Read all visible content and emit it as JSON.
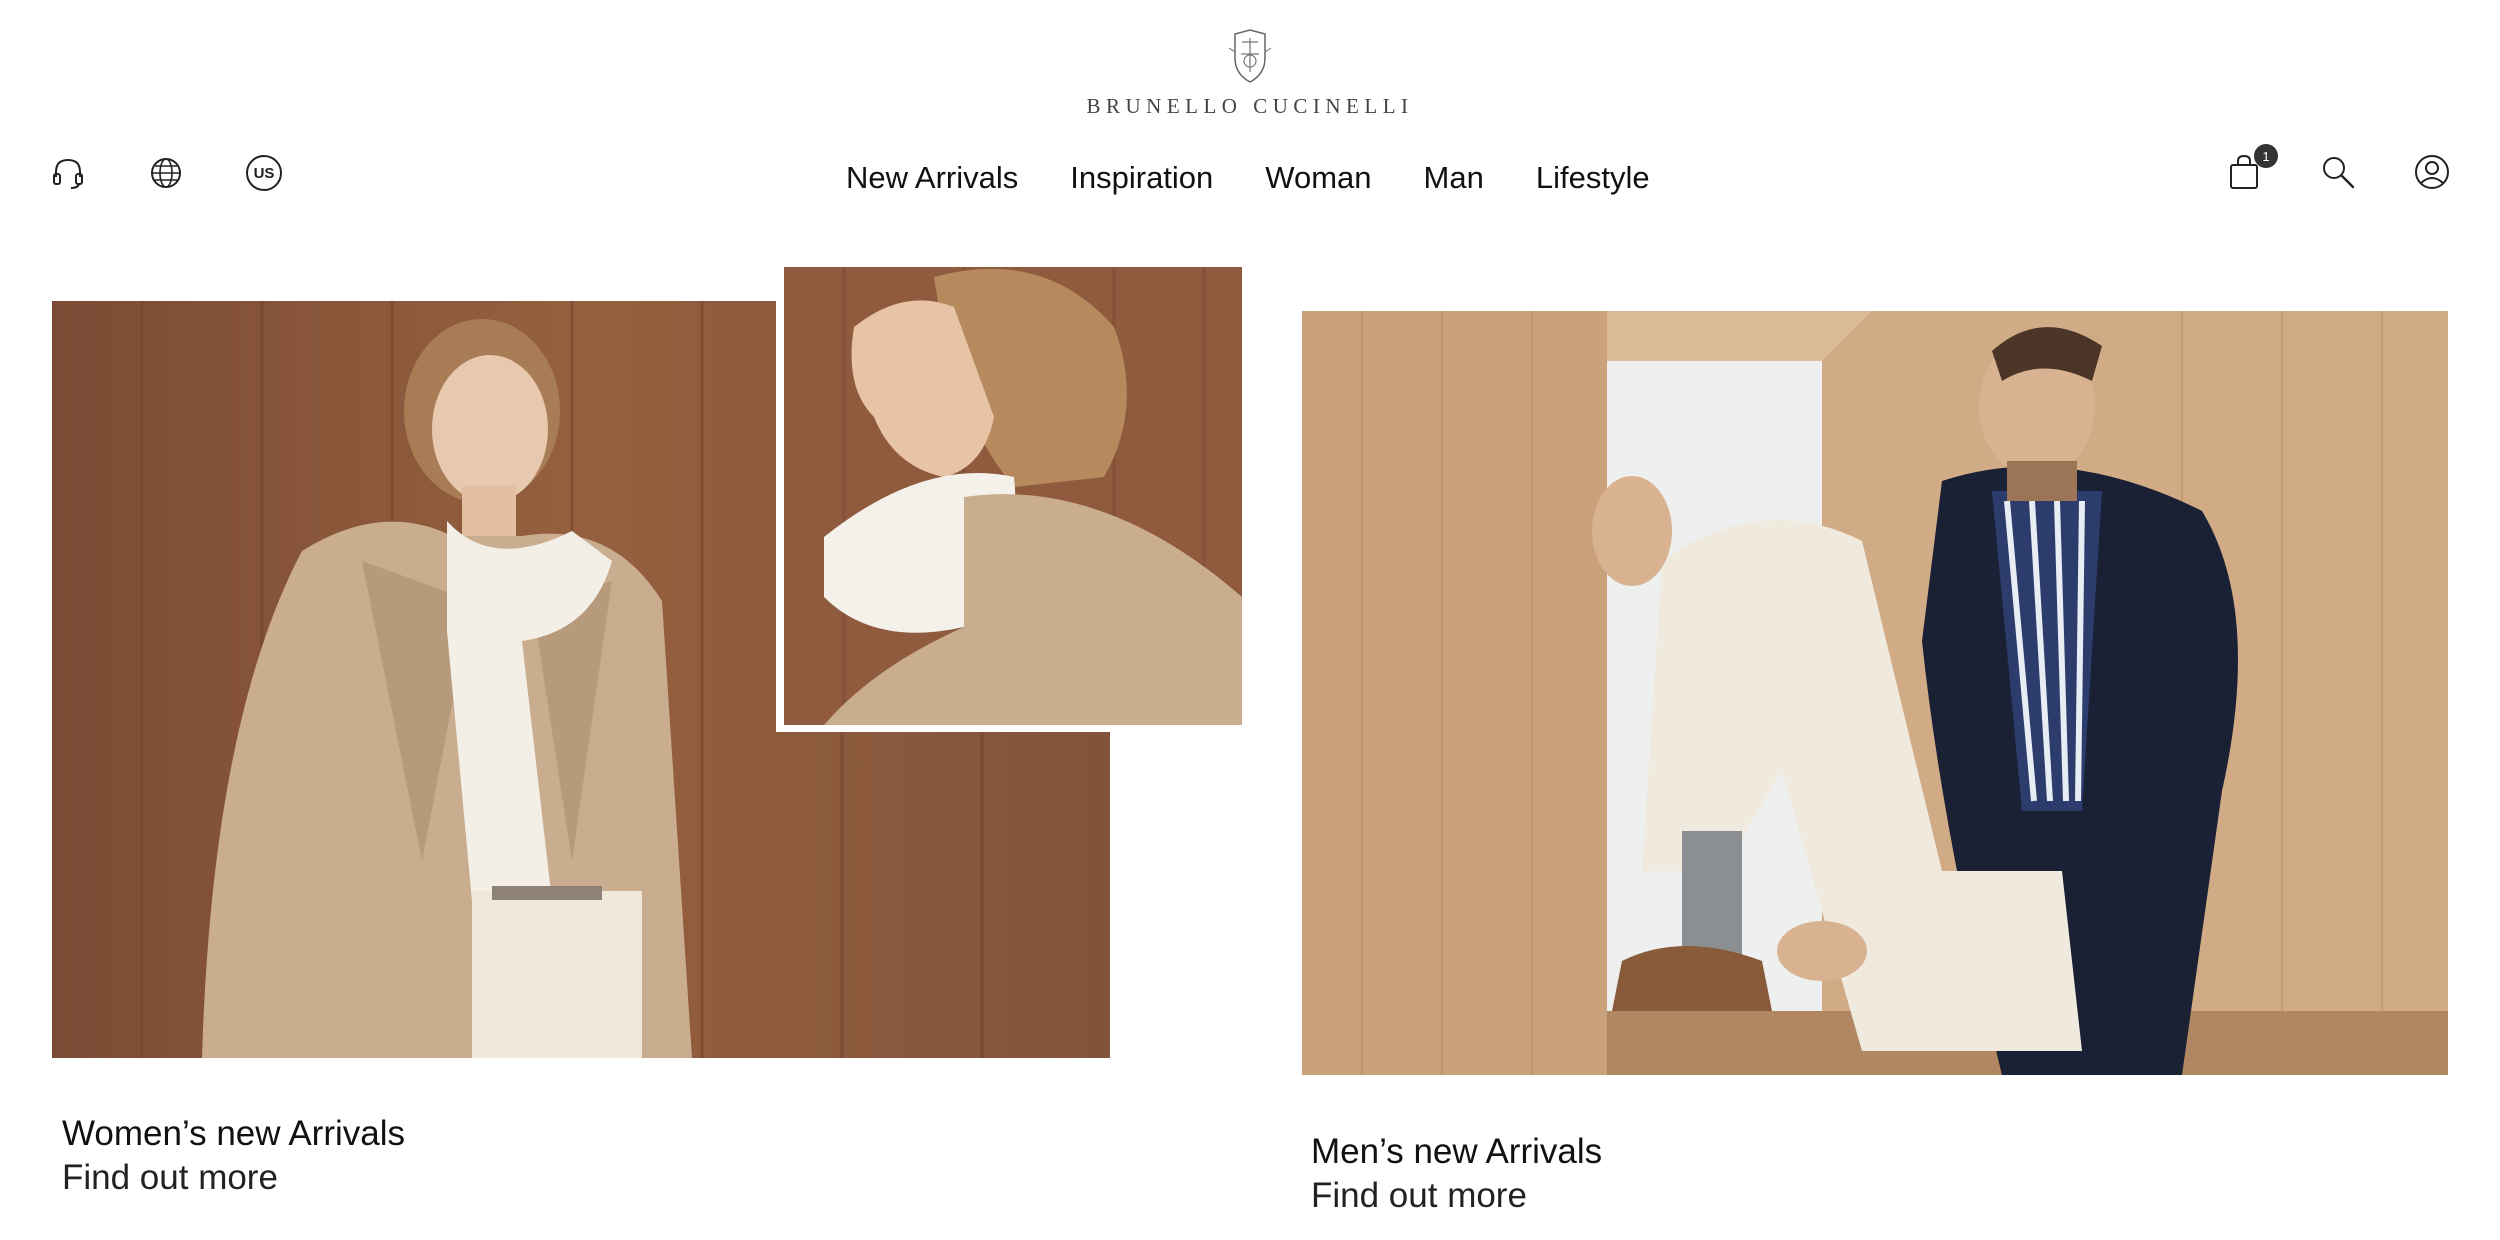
{
  "brand": {
    "name": "BRUNELLO CUCINELLI",
    "logo_icon": "crest-icon"
  },
  "header": {
    "left_tools": [
      {
        "name": "customer-service",
        "icon": "headset-icon"
      },
      {
        "name": "country",
        "icon": "globe-icon"
      },
      {
        "name": "locale",
        "label": "US"
      }
    ],
    "nav": [
      {
        "label": "New Arrivals"
      },
      {
        "label": "Inspiration"
      },
      {
        "label": "Woman"
      },
      {
        "label": "Man"
      },
      {
        "label": "Lifestyle"
      }
    ],
    "right_tools": [
      {
        "name": "shopping-bag",
        "icon": "shopping-bag-icon",
        "count": "1"
      },
      {
        "name": "search",
        "icon": "search-icon"
      },
      {
        "name": "account",
        "icon": "user-icon"
      }
    ]
  },
  "sections": {
    "women": {
      "title": "Women’s new Arrivals",
      "cta": "Find out more"
    },
    "men": {
      "title": "Men’s new Arrivals",
      "cta": "Find out more"
    }
  },
  "colors": {
    "text": "#111111",
    "badge": "#333333",
    "wood_dark": "#8a553c",
    "wood_light": "#d0ab85",
    "camel": "#c9ad8e",
    "cream": "#f1ece1",
    "navy": "#1b2135"
  }
}
